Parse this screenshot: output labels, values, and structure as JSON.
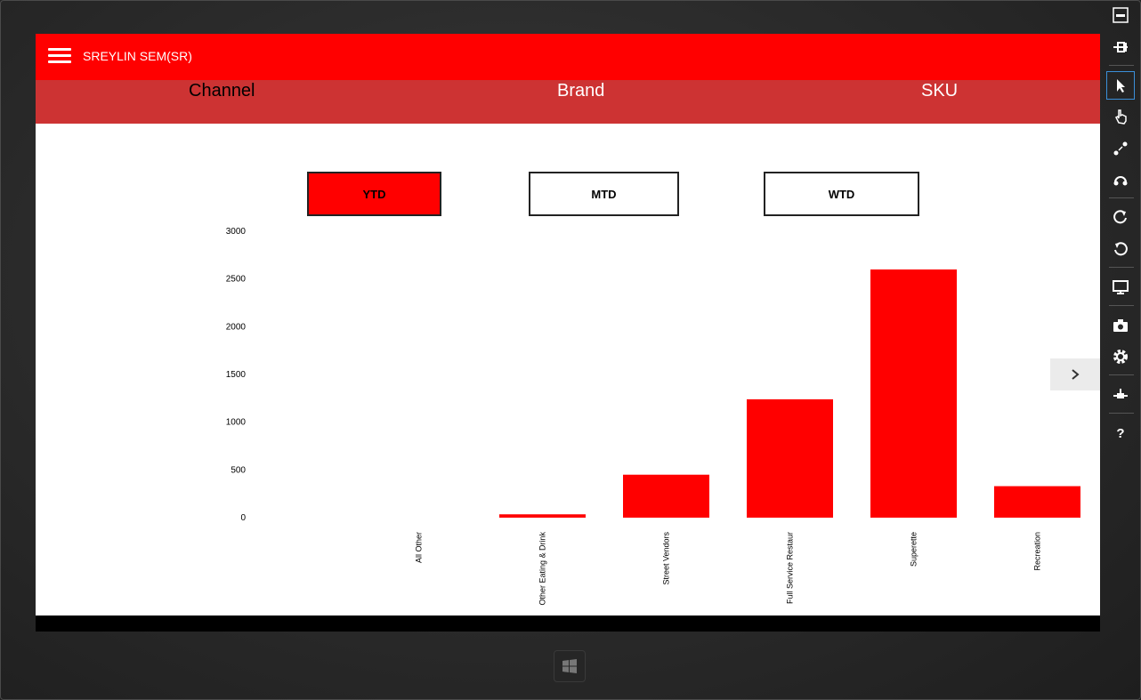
{
  "app": {
    "user_name": "SREYLIN SEM(SR)",
    "accent_color": "#ff0000",
    "nav_color": "#cd3333"
  },
  "nav": {
    "tabs": [
      {
        "label": "Channel",
        "active": true
      },
      {
        "label": "Brand",
        "active": false
      },
      {
        "label": "SKU",
        "active": false
      }
    ]
  },
  "period": {
    "buttons": [
      {
        "label": "YTD",
        "selected": true
      },
      {
        "label": "MTD",
        "selected": false
      },
      {
        "label": "WTD",
        "selected": false
      }
    ]
  },
  "chart_data": {
    "type": "bar",
    "categories": [
      "All Other",
      "Other Eating & Drink",
      "Street Vendors",
      "Full Service Restaur",
      "Superette",
      "Recreation"
    ],
    "values": [
      0,
      35,
      450,
      1240,
      2600,
      330
    ],
    "ylim": [
      0,
      3000
    ],
    "yticks": [
      0,
      500,
      1000,
      1500,
      2000,
      2500,
      3000
    ],
    "color": "#ff0000",
    "grid": false,
    "legend": "none"
  },
  "toolbar": {
    "icons": [
      "minimize-icon",
      "pin-icon",
      "mouse-mode-icon",
      "touch-mode-icon",
      "pinch-zoom-icon",
      "rotate-touch-icon",
      "rotate-clockwise-icon",
      "rotate-counterclockwise-icon",
      "resolution-icon",
      "screenshot-icon",
      "settings-icon",
      "network-icon",
      "help-icon"
    ]
  }
}
